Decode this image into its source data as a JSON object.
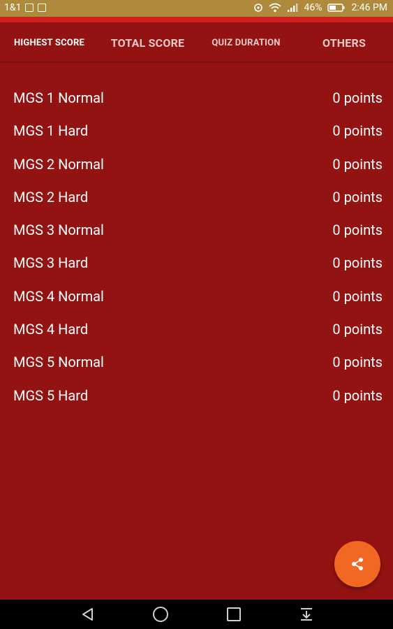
{
  "status_bar": {
    "carrier": "1&1",
    "battery": "46%",
    "time": "2:46 PM"
  },
  "tabs": [
    {
      "label": "HIGHEST SCORE",
      "active": true
    },
    {
      "label": "TOTAL SCORE",
      "active": false
    },
    {
      "label": "QUIZ DURATION",
      "active": false
    },
    {
      "label": "OTHERS",
      "active": false
    }
  ],
  "scores": [
    {
      "name": "MGS 1 Normal",
      "points": "0 points"
    },
    {
      "name": "MGS 1 Hard",
      "points": "0 points"
    },
    {
      "name": "MGS 2 Normal",
      "points": "0 points"
    },
    {
      "name": "MGS 2 Hard",
      "points": "0 points"
    },
    {
      "name": "MGS 3 Normal",
      "points": "0 points"
    },
    {
      "name": "MGS 3 Hard",
      "points": "0 points"
    },
    {
      "name": "MGS 4 Normal",
      "points": "0 points"
    },
    {
      "name": "MGS 4 Hard",
      "points": "0 points"
    },
    {
      "name": "MGS 5 Normal",
      "points": "0 points"
    },
    {
      "name": "MGS 5 Hard",
      "points": "0 points"
    }
  ],
  "fab": {
    "icon": "share-icon"
  },
  "nav": {
    "back_icon": "back-icon",
    "home_icon": "home-icon",
    "recents_icon": "recents-icon",
    "notifications_icon": "pull-down-icon"
  },
  "colors": {
    "background": "#931312",
    "accent_line": "#d11f1f",
    "status_bar": "#b08a3c",
    "fab": "#f26722"
  }
}
